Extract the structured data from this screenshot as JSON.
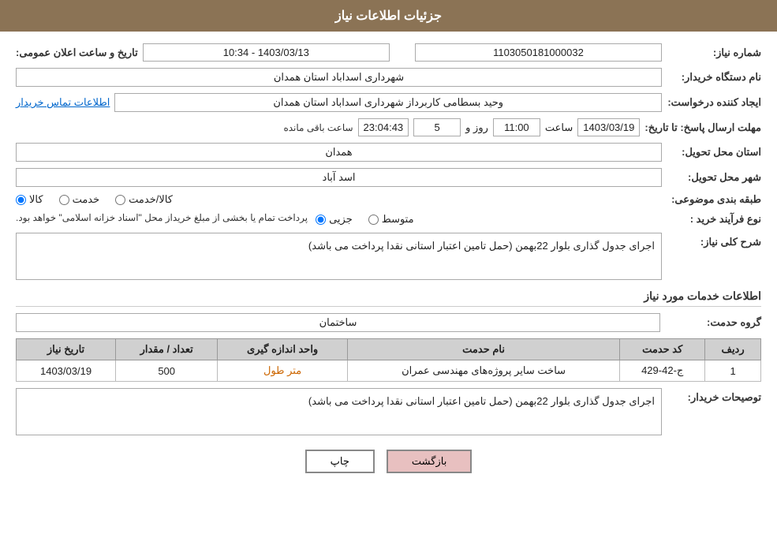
{
  "header": {
    "title": "جزئیات اطلاعات نیاز"
  },
  "fields": {
    "need_number_label": "شماره نیاز:",
    "need_number_value": "1103050181000032",
    "announce_datetime_label": "تاریخ و ساعت اعلان عمومی:",
    "announce_datetime_value": "1403/03/13 - 10:34",
    "buyer_name_label": "نام دستگاه خریدار:",
    "buyer_name_value": "شهرداری اسداباد استان همدان",
    "creator_label": "ایجاد کننده درخواست:",
    "creator_value": "وحید  بسطامی کاربرداز شهرداری اسداباد استان همدان",
    "creator_link": "اطلاعات تماس خریدار",
    "response_deadline_label": "مهلت ارسال پاسخ: تا تاریخ:",
    "response_date": "1403/03/19",
    "response_time_label": "ساعت",
    "response_time": "11:00",
    "response_days_label": "روز و",
    "response_days": "5",
    "response_countdown": "23:04:43",
    "response_remaining_label": "ساعت باقی مانده",
    "province_label": "استان محل تحویل:",
    "province_value": "همدان",
    "city_label": "شهر محل تحویل:",
    "city_value": "اسد آباد",
    "category_label": "طبقه بندی موضوعی:",
    "category_radio_1": "کالا",
    "category_radio_2": "خدمت",
    "category_radio_3": "کالا/خدمت",
    "purchase_type_label": "نوع فرآیند خرید :",
    "purchase_radio_1": "جزیی",
    "purchase_radio_2": "متوسط",
    "purchase_notice": "پرداخت تمام یا بخشی از مبلغ خریداز محل \"اسناد خزانه اسلامی\" خواهد بود.",
    "description_label": "شرح کلی نیاز:",
    "description_value": "اجرای جدول گذاری بلوار 22بهمن (حمل تامین اعتبار استانی نقدا پرداخت می باشد)",
    "services_section_title": "اطلاعات خدمات مورد نیاز",
    "service_group_label": "گروه حدمت:",
    "service_group_value": "ساختمان",
    "table": {
      "headers": [
        "ردیف",
        "کد حدمت",
        "نام حدمت",
        "واحد اندازه گیری",
        "تعداد / مقدار",
        "تاریخ نیاز"
      ],
      "rows": [
        {
          "row_number": "1",
          "service_code": "ج-42-429",
          "service_name": "ساخت سایر پروژه‌های مهندسی عمران",
          "unit": "متر طول",
          "quantity": "500",
          "date": "1403/03/19"
        }
      ]
    },
    "buyer_desc_label": "توصیحات خریدار:",
    "buyer_desc_value": "اجرای جدول گذاری بلوار 22بهمن (حمل تامین اعتبار استانی نقدا پرداخت می باشد)"
  },
  "buttons": {
    "print_label": "چاپ",
    "back_label": "بازگشت"
  }
}
